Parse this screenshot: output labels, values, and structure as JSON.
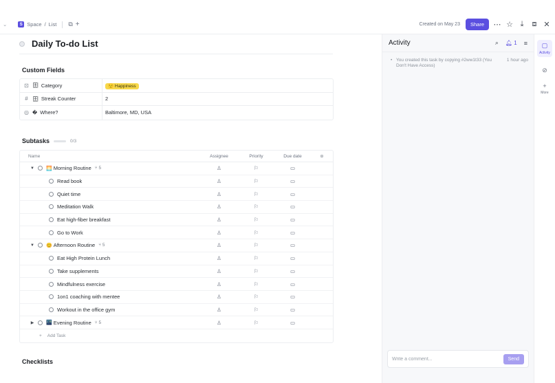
{
  "breadcrumb": {
    "space_initial": "S",
    "space": "Space",
    "separator": "/",
    "list": "List"
  },
  "topbar": {
    "created": "Created on May 23",
    "share_label": "Share"
  },
  "task": {
    "title": "Daily To-do List"
  },
  "custom_fields": {
    "title": "Custom Fields",
    "rows": [
      {
        "icon": "dropdown-icon",
        "emoji": "🗄",
        "label": "Category",
        "value": "😌 Happiness"
      },
      {
        "icon": "hash-icon",
        "emoji": "🗄",
        "label": "Streak Counter",
        "value": "2"
      },
      {
        "icon": "location-icon",
        "emoji": "�",
        "label": "Where?",
        "value": "Baltimore, MD, USA"
      }
    ]
  },
  "subtasks": {
    "title": "Subtasks",
    "progress": "0/3",
    "progress_fraction": 0,
    "columns": {
      "name": "Name",
      "assignee": "Assignee",
      "priority": "Priority",
      "due": "Due date"
    },
    "groups": [
      {
        "emoji": "🌅",
        "name": "Morning Routine",
        "count": "5",
        "expanded": true,
        "items": [
          "Read book",
          "Quiet time",
          "Meditation Walk",
          "Eat high-fiber breakfast",
          "Go to Work"
        ]
      },
      {
        "emoji": "😊",
        "name": "Afternoon Routine",
        "count": "5",
        "expanded": true,
        "items": [
          "Eat High Protein Lunch",
          "Take supplements",
          "Mindfulness exercise",
          "1on1 coaching with mentee",
          "Workout in the office gym"
        ]
      },
      {
        "emoji": "🌃",
        "name": "Evening Routine",
        "count": "5",
        "expanded": false,
        "items": []
      }
    ],
    "add_task": "Add Task"
  },
  "checklists": {
    "title": "Checklists"
  },
  "activity": {
    "title": "Activity",
    "notification_count": "1",
    "entry_text": "You created this task by copying #2ww1t33 (You Don't Have Access)",
    "entry_time": "1 hour ago",
    "comment_placeholder": "Write a comment...",
    "send_label": "Send"
  },
  "rail": {
    "activity_label": "Activity",
    "more_label": "More"
  },
  "colors": {
    "accent": "#5b4fe0",
    "tag_yellow": "#f7d84b"
  }
}
